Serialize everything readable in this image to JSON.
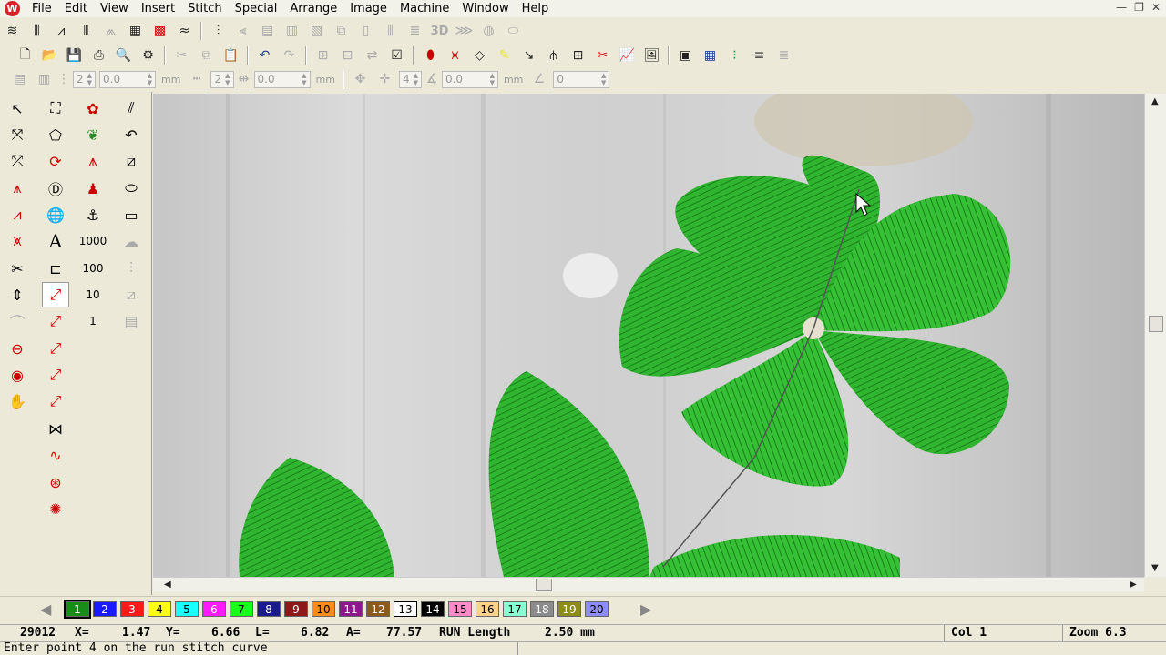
{
  "menu": [
    "File",
    "Edit",
    "View",
    "Insert",
    "Stitch",
    "Special",
    "Arrange",
    "Image",
    "Machine",
    "Window",
    "Help"
  ],
  "toolbar3": {
    "spin1": "2",
    "val1": "0.0",
    "unit1": "mm",
    "spin2": "2",
    "val2": "0.0",
    "unit2": "mm",
    "spin3": "4",
    "val3": "0.0",
    "unit3": "mm",
    "val4": "0"
  },
  "toolbar1": {
    "label_3d": "3D"
  },
  "tool_labels": {
    "text_tool": "A",
    "n1000": "1000",
    "n100": "100",
    "n10": "10",
    "n1": "1"
  },
  "palette": [
    {
      "label": "1",
      "color": "#1a8c1a"
    },
    {
      "label": "2",
      "color": "#1a1aff"
    },
    {
      "label": "3",
      "color": "#ff1a1a"
    },
    {
      "label": "4",
      "color": "#ffff1a"
    },
    {
      "label": "5",
      "color": "#1affff"
    },
    {
      "label": "6",
      "color": "#ff1aff"
    },
    {
      "label": "7",
      "color": "#1aff1a"
    },
    {
      "label": "8",
      "color": "#1a1a8c"
    },
    {
      "label": "9",
      "color": "#8c1a1a"
    },
    {
      "label": "10",
      "color": "#ff8c1a"
    },
    {
      "label": "11",
      "color": "#8c1a8c"
    },
    {
      "label": "12",
      "color": "#8c5a1a"
    },
    {
      "label": "13",
      "color": "#ffffff"
    },
    {
      "label": "14",
      "color": "#000000"
    },
    {
      "label": "15",
      "color": "#ff8cc8"
    },
    {
      "label": "16",
      "color": "#ffd28c"
    },
    {
      "label": "17",
      "color": "#8cffd2"
    },
    {
      "label": "18",
      "color": "#8c8c8c"
    },
    {
      "label": "19",
      "color": "#8c8c1a"
    },
    {
      "label": "20",
      "color": "#8c8cff"
    }
  ],
  "status": {
    "stitch_count": "29012",
    "x_label": "X=",
    "x_val": "1.47",
    "y_label": "Y=",
    "y_val": "6.66",
    "l_label": "L=",
    "l_val": "6.82",
    "a_label": "A=",
    "a_val": "77.57",
    "mode": "RUN Length",
    "length": "2.50 mm",
    "col": "Col 1",
    "zoom": "Zoom 6.3"
  },
  "prompt": "Enter point 4 on the run stitch curve"
}
